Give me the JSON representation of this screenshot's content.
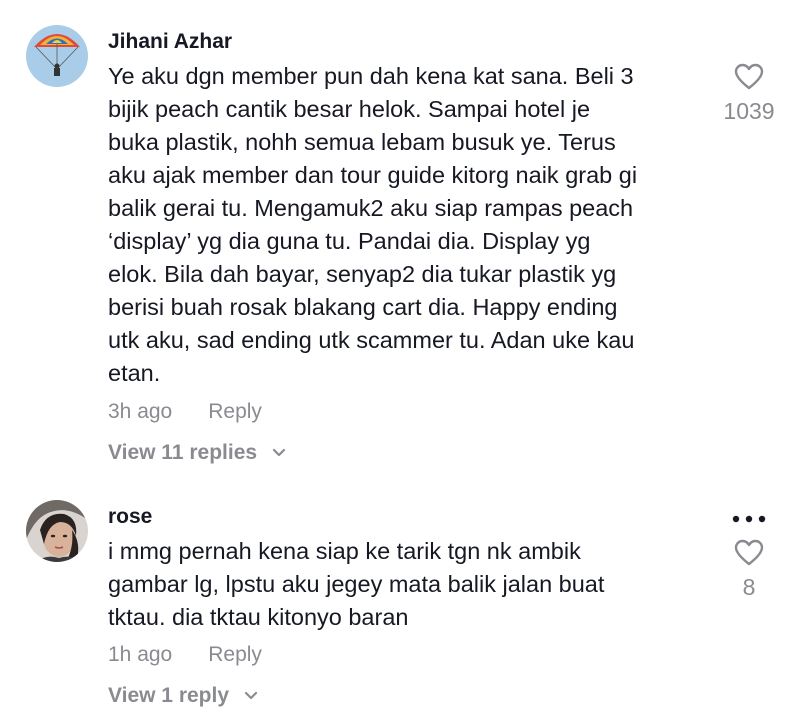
{
  "comments": [
    {
      "username": "Jihani Azhar",
      "text_lines": [
        "Ye aku dgn member pun dah kena kat sana. Beli 3",
        "bijik peach cantik besar helok. Sampai hotel je",
        "buka plastik, nohh semua lebam busuk ye. Terus",
        "aku ajak member dan tour guide kitorg naik grab gi",
        "balik gerai tu. Mengamuk2 aku siap rampas peach",
        "‘display’ yg dia guna tu. Pandai dia. Display yg",
        "elok. Bila dah bayar, senyap2 dia tukar plastik yg",
        "berisi buah rosak blakang cart dia. Happy ending",
        "utk aku, sad ending utk scammer tu. Adan uke kau",
        "etan."
      ],
      "time": "3h ago",
      "reply_label": "Reply",
      "view_replies": "View 11 replies",
      "likes": "1039"
    },
    {
      "username": "rose",
      "text_lines": [
        "i mmg pernah kena siap ke tarik tgn nk ambik",
        "gambar lg, lpstu aku jegey mata balik jalan buat",
        "tktau. dia tktau kitonyo baran"
      ],
      "time": "1h ago",
      "reply_label": "Reply",
      "view_replies": "View 1 reply",
      "likes": "8"
    }
  ],
  "icons": {
    "like": "heart-outline-icon",
    "expand": "chevron-down-icon",
    "more": "more-dots-icon"
  },
  "colors": {
    "text": "#161823",
    "secondary": "#8a8b91"
  }
}
